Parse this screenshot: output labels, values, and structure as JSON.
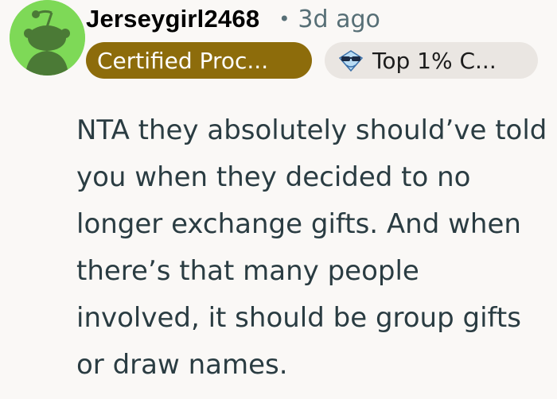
{
  "comment": {
    "username": "Jerseygirl2468",
    "separator": "•",
    "time_ago": "3d ago",
    "flairs": [
      {
        "label": "Certified Proc...",
        "color": "#8d6c0b",
        "icon": ""
      },
      {
        "label": "Top 1% C...",
        "color": "#eae6e2",
        "icon": "sunglasses-emoji-icon"
      }
    ],
    "body": "NTA they absolutely should’ve told you when they decided to no longer exchange gifts. And when there’s that many people involved, it should be group gifts or draw names."
  },
  "avatar": {
    "icon": "snoo-avatar-icon",
    "background": "#7ed957"
  }
}
